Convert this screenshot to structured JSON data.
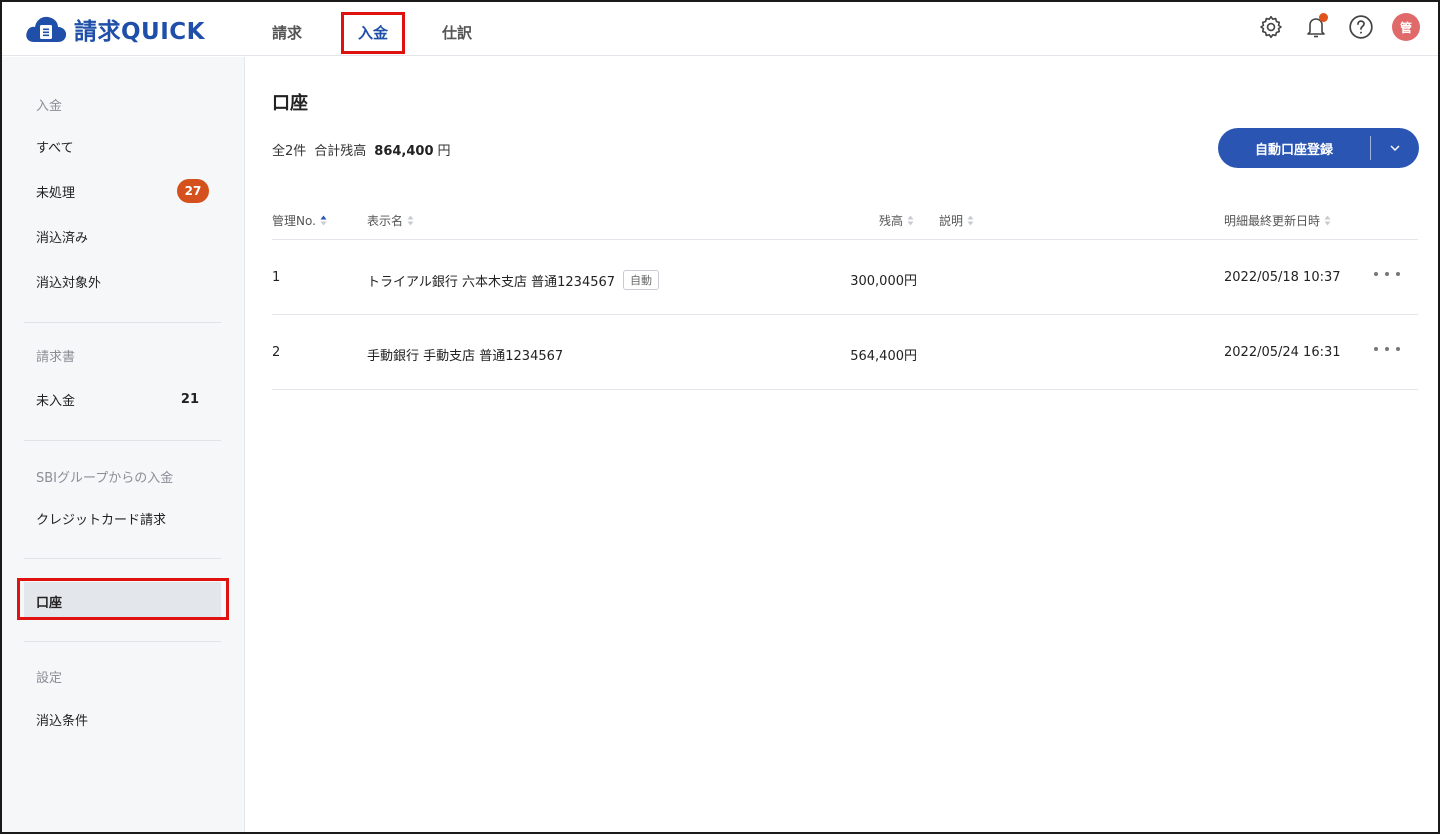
{
  "app": {
    "name": "請求QUICK",
    "brand_color": "#1f4fa8",
    "accent_color": "#d4501c"
  },
  "nav": {
    "tabs": [
      {
        "label": "請求"
      },
      {
        "label": "入金"
      },
      {
        "label": "仕訳"
      }
    ],
    "active": "入金"
  },
  "header_icons": [
    "gear-icon",
    "bell-icon",
    "help-icon"
  ],
  "user": {
    "avatar_initial": "管"
  },
  "sidebar": {
    "section_deposit": "入金",
    "item_all": "すべて",
    "item_unprocessed": "未処理",
    "item_unprocessed_badge": "27",
    "item_cleared": "消込済み",
    "item_excluded": "消込対象外",
    "section_invoice": "請求書",
    "item_unpaid": "未入金",
    "item_unpaid_count": "21",
    "section_sbi": "SBIグループからの入金",
    "item_credit": "クレジットカード請求",
    "item_account": "口座",
    "section_settings": "設定",
    "item_conditions": "消込条件"
  },
  "main": {
    "title": "口座",
    "summary": {
      "count_label": "全2件",
      "balance_label": "合計残高",
      "balance_value": "864,400",
      "unit": "円"
    },
    "primary_button": "自動口座登録",
    "columns": {
      "id": "管理No.",
      "name": "表示名",
      "balance": "残高",
      "description": "説明",
      "updated": "明細最終更新日時"
    },
    "rows": [
      {
        "id": "1",
        "name": "トライアル銀行 六本木支店 普通1234567",
        "tag": "自動",
        "balance": "300,000円",
        "description": "",
        "updated": "2022/05/18 10:37"
      },
      {
        "id": "2",
        "name": "手動銀行 手動支店 普通1234567",
        "tag": "",
        "balance": "564,400円",
        "description": "",
        "updated": "2022/05/24 16:31"
      }
    ]
  }
}
